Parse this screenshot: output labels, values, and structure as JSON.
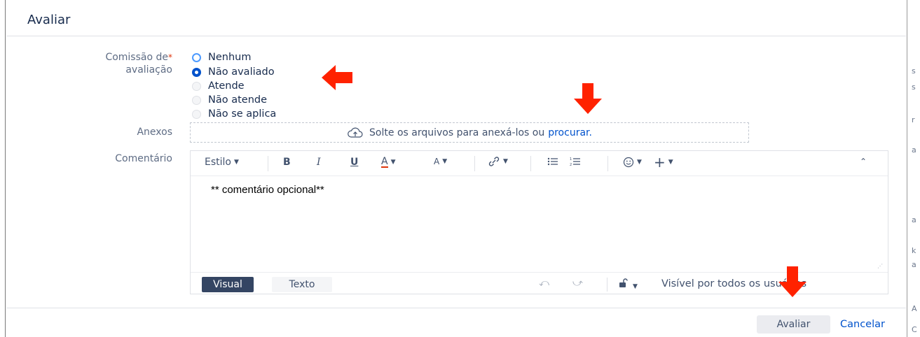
{
  "dialog": {
    "title": "Avaliar"
  },
  "commission": {
    "label_line1": "Comissão de",
    "label_line2": "avaliação",
    "required_mark": "*",
    "options": [
      {
        "label": "Nenhum",
        "state": "enabled"
      },
      {
        "label": "Não avaliado",
        "state": "checked"
      },
      {
        "label": "Atende",
        "state": "disabled"
      },
      {
        "label": "Não atende",
        "state": "disabled"
      },
      {
        "label": "Não se aplica",
        "state": "disabled"
      }
    ]
  },
  "attachments": {
    "label": "Anexos",
    "drop_text": "Solte os arquivos para anexá-los ou",
    "browse_link": "procurar."
  },
  "comment": {
    "label": "Comentário",
    "toolbar": {
      "style_label": "Estilo",
      "bold": "B",
      "italic": "I",
      "underline": "U",
      "text_color": "A",
      "more_format": "A",
      "link_icon": "link-icon",
      "bullet_list_icon": "bullet-list-icon",
      "numbered_list_icon": "numbered-list-icon",
      "emoji_icon": "emoji-icon",
      "insert_label": "+",
      "collapse_icon": "collapse-toolbar-icon"
    },
    "body": "** comentário opcional**",
    "mode_visual": "Visual",
    "mode_text": "Texto",
    "visibility": "Visível por todos os usuários"
  },
  "actions": {
    "submit": "Avaliar",
    "cancel": "Cancelar"
  },
  "colors": {
    "primary": "#0052cc",
    "annotation_arrow": "#ff2200",
    "visual_button": "#344563"
  }
}
